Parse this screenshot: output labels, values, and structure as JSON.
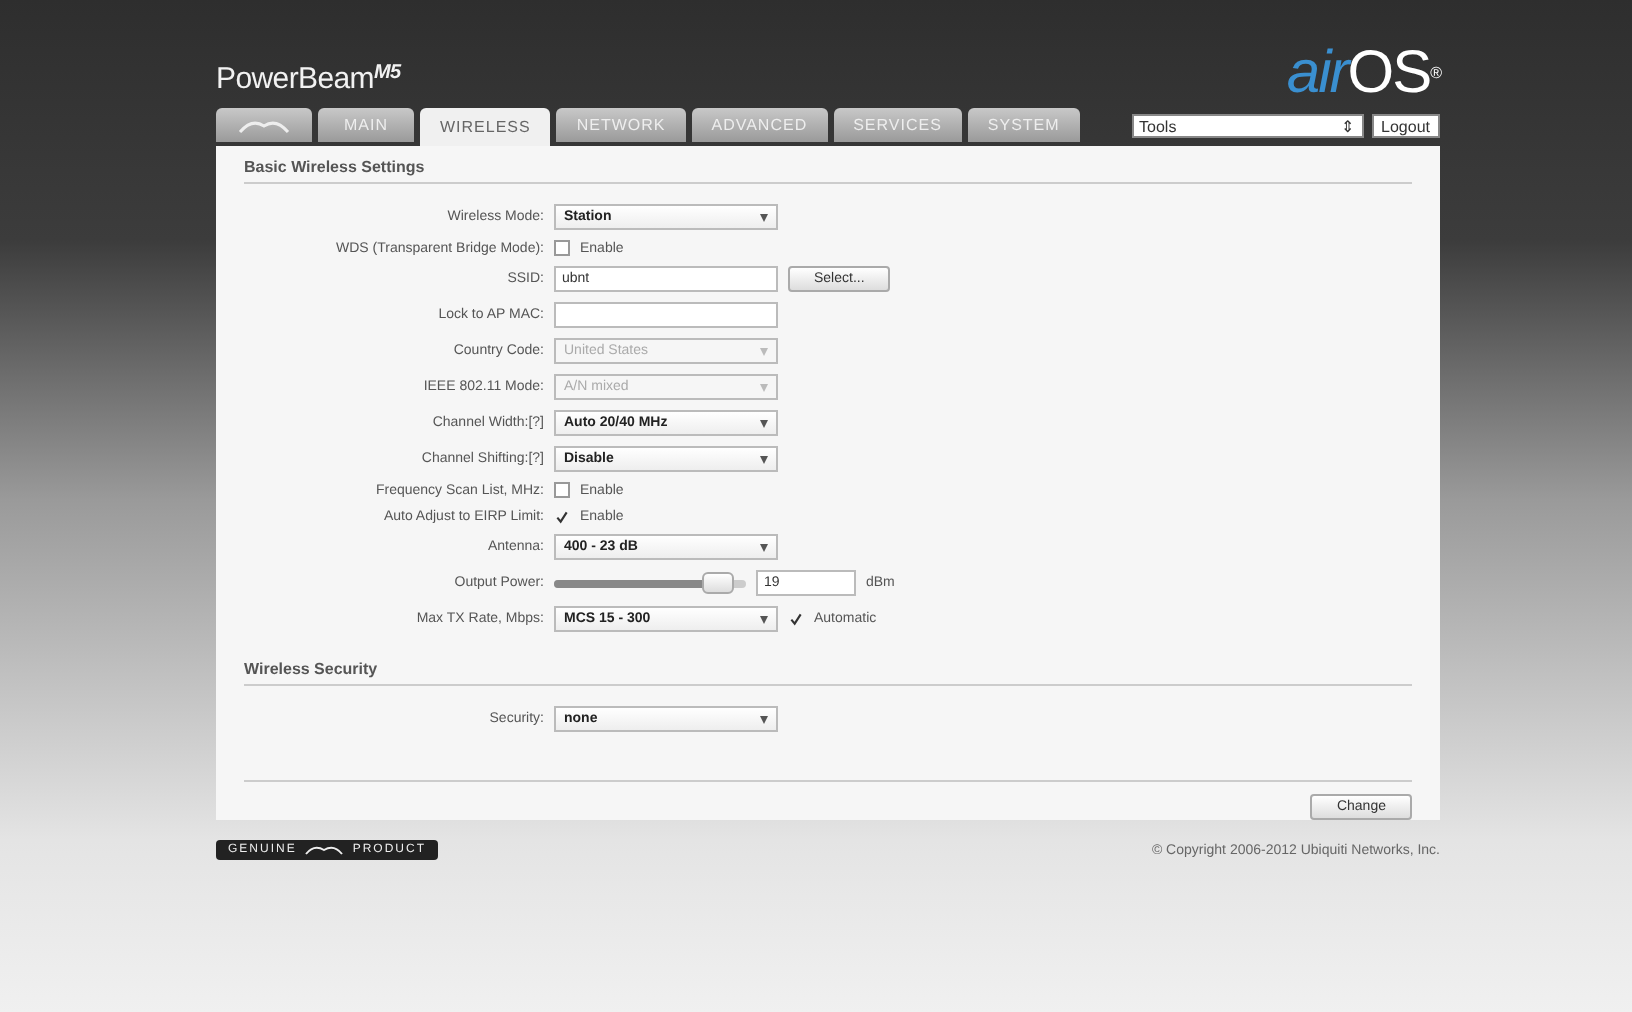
{
  "header": {
    "product": "PowerBeam",
    "model": "M5",
    "brand_prefix": "air",
    "brand_suffix": "OS",
    "brand_mark": "®"
  },
  "tabs": [
    {
      "kind": "logo",
      "selected": false
    },
    {
      "label": "MAIN",
      "selected": false
    },
    {
      "label": "WIRELESS",
      "selected": true
    },
    {
      "label": "NETWORK",
      "selected": false
    },
    {
      "label": "ADVANCED",
      "selected": false
    },
    {
      "label": "SERVICES",
      "selected": false
    },
    {
      "label": "SYSTEM",
      "selected": false
    }
  ],
  "tools": {
    "value": "Tools",
    "arrow": "⇕"
  },
  "logout": "Logout",
  "basic": {
    "title": "Basic Wireless Settings",
    "rows": [
      {
        "kind": "select",
        "label": "Wireless Mode:",
        "value": "Station",
        "disabled": false
      },
      {
        "kind": "checkbox",
        "label": "WDS (Transparent Bridge Mode):",
        "text": "Enable",
        "checked": false
      },
      {
        "kind": "text",
        "label": "SSID:",
        "value": "ubnt",
        "button": "Select..."
      },
      {
        "kind": "text",
        "label": "Lock to AP MAC:",
        "value": ""
      },
      {
        "kind": "select",
        "label": "Country Code:",
        "value": "United States",
        "disabled": true
      },
      {
        "kind": "select",
        "label": "IEEE 802.11 Mode:",
        "value": "A/N mixed",
        "disabled": true
      },
      {
        "kind": "select",
        "label": "Channel Width:[?]",
        "value": "Auto 20/40 MHz",
        "disabled": false
      },
      {
        "kind": "select",
        "label": "Channel Shifting:[?]",
        "value": "Disable",
        "disabled": false
      },
      {
        "kind": "checkbox",
        "label": "Frequency Scan List, MHz:",
        "text": "Enable",
        "checked": false
      },
      {
        "kind": "checkbox",
        "label": "Auto Adjust to EIRP Limit:",
        "text": "Enable",
        "checked": true
      },
      {
        "kind": "select",
        "label": "Antenna:",
        "value": "400 - 23 dB",
        "disabled": false
      },
      {
        "kind": "slider",
        "label": "Output Power:",
        "level": 0.85,
        "value": "19",
        "unit": "dBm"
      },
      {
        "kind": "select",
        "label": "Max TX Rate, Mbps:",
        "value": "MCS 15 - 300",
        "disabled": false,
        "check_text": "Automatic",
        "checked": true
      }
    ]
  },
  "security": {
    "title": "Wireless Security",
    "rows": [
      {
        "kind": "select",
        "label": "Security:",
        "value": "none",
        "disabled": false
      }
    ]
  },
  "change": "Change",
  "footer": {
    "badge_left": "GENUINE",
    "badge_right": "PRODUCT",
    "copyright": "© Copyright 2006-2012 Ubiquiti Networks, Inc."
  }
}
